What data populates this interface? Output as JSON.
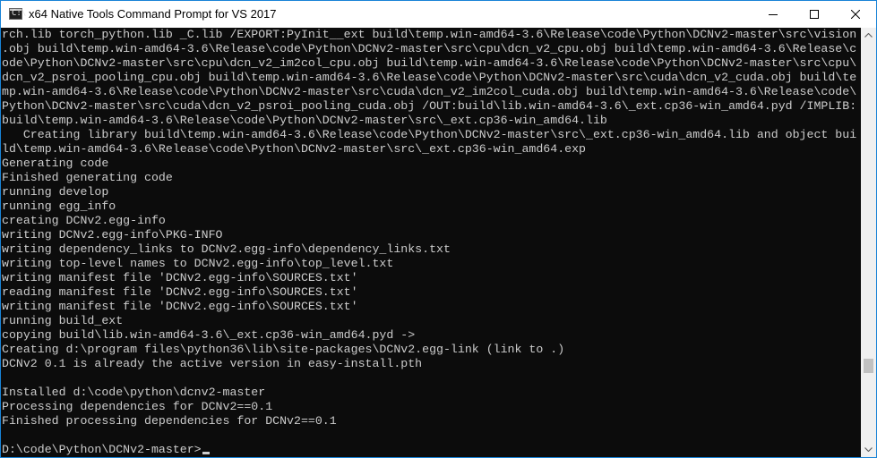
{
  "window": {
    "title": "x64 Native Tools Command Prompt for VS 2017"
  },
  "controls": {
    "minimize_icon": "minimize-icon",
    "maximize_icon": "maximize-icon",
    "close_icon": "close-icon"
  },
  "console": {
    "lines": [
      "rch.lib torch_python.lib _C.lib /EXPORT:PyInit__ext build\\temp.win-amd64-3.6\\Release\\code\\Python\\DCNv2-master\\src\\vision",
      ".obj build\\temp.win-amd64-3.6\\Release\\code\\Python\\DCNv2-master\\src\\cpu\\dcn_v2_cpu.obj build\\temp.win-amd64-3.6\\Release\\c",
      "ode\\Python\\DCNv2-master\\src\\cpu\\dcn_v2_im2col_cpu.obj build\\temp.win-amd64-3.6\\Release\\code\\Python\\DCNv2-master\\src\\cpu\\",
      "dcn_v2_psroi_pooling_cpu.obj build\\temp.win-amd64-3.6\\Release\\code\\Python\\DCNv2-master\\src\\cuda\\dcn_v2_cuda.obj build\\te",
      "mp.win-amd64-3.6\\Release\\code\\Python\\DCNv2-master\\src\\cuda\\dcn_v2_im2col_cuda.obj build\\temp.win-amd64-3.6\\Release\\code\\",
      "Python\\DCNv2-master\\src\\cuda\\dcn_v2_psroi_pooling_cuda.obj /OUT:build\\lib.win-amd64-3.6\\_ext.cp36-win_amd64.pyd /IMPLIB:",
      "build\\temp.win-amd64-3.6\\Release\\code\\Python\\DCNv2-master\\src\\_ext.cp36-win_amd64.lib",
      "   Creating library build\\temp.win-amd64-3.6\\Release\\code\\Python\\DCNv2-master\\src\\_ext.cp36-win_amd64.lib and object bui",
      "ld\\temp.win-amd64-3.6\\Release\\code\\Python\\DCNv2-master\\src\\_ext.cp36-win_amd64.exp",
      "Generating code",
      "Finished generating code",
      "running develop",
      "running egg_info",
      "creating DCNv2.egg-info",
      "writing DCNv2.egg-info\\PKG-INFO",
      "writing dependency_links to DCNv2.egg-info\\dependency_links.txt",
      "writing top-level names to DCNv2.egg-info\\top_level.txt",
      "writing manifest file 'DCNv2.egg-info\\SOURCES.txt'",
      "reading manifest file 'DCNv2.egg-info\\SOURCES.txt'",
      "writing manifest file 'DCNv2.egg-info\\SOURCES.txt'",
      "running build_ext",
      "copying build\\lib.win-amd64-3.6\\_ext.cp36-win_amd64.pyd ->",
      "Creating d:\\program files\\python36\\lib\\site-packages\\DCNv2.egg-link (link to .)",
      "DCNv2 0.1 is already the active version in easy-install.pth",
      "",
      "Installed d:\\code\\python\\dcnv2-master",
      "Processing dependencies for DCNv2==0.1",
      "Finished processing dependencies for DCNv2==0.1",
      "",
      "D:\\code\\Python\\DCNv2-master>"
    ]
  },
  "colors": {
    "console_bg": "#0c0c0c",
    "console_fg": "#cccccc",
    "window_border": "#1883d7"
  }
}
